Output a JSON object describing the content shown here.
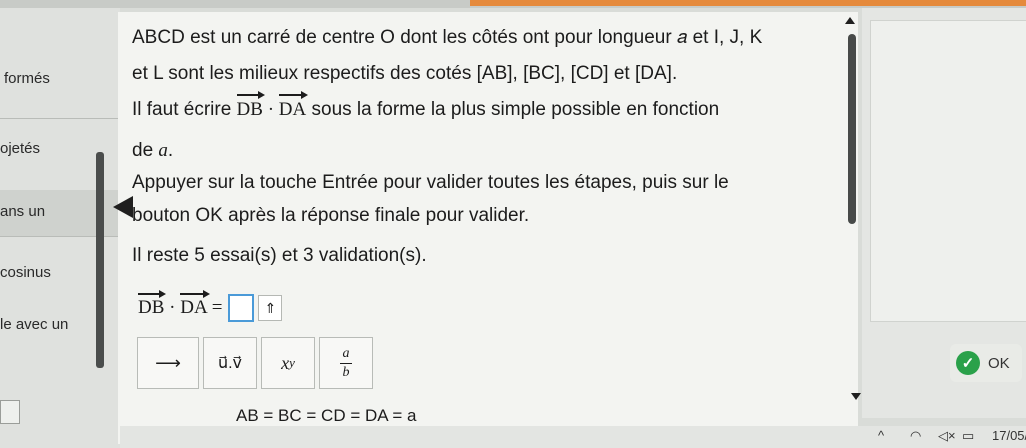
{
  "sidebar": {
    "items": [
      {
        "label": "formés"
      },
      {
        "label": "ojetés"
      },
      {
        "label": "ans un"
      },
      {
        "label": "cosinus"
      },
      {
        "label": "le avec un"
      }
    ]
  },
  "problem": {
    "line1": "ABCD est un carré de centre O dont les côtés ont pour longueur 𝑎 et I, J, K",
    "line2": "et L sont les milieux respectifs des cotés [AB], [BC], [CD] et [DA].",
    "line3_pre": "Il faut écrire ",
    "vec1": "DB",
    "dot": " · ",
    "vec2": "DA",
    "line3_post": " sous la forme la plus simple possible en fonction",
    "line4_pre": "de ",
    "line4_var": "a",
    "line4_post": ".",
    "line5": "Appuyer sur la touche Entrée pour valider toutes les étapes, puis sur le",
    "line6": "bouton OK après la réponse finale pour valider.",
    "line7": "Il reste 5 essai(s) et 3 validation(s)."
  },
  "answer": {
    "vec1": "DB",
    "dot": " · ",
    "vec2": "DA",
    "equals": "=",
    "toggle_symbol": "⇑"
  },
  "toolbar": {
    "vector_arrow": "⟶",
    "dot_product": "u⃗.v⃗",
    "power": "x",
    "power_exp": "y",
    "frac_num": "a",
    "frac_den": "b"
  },
  "footer": {
    "equation": "AB = BC = CD = DA = a"
  },
  "ok_button": {
    "label": "OK",
    "check": "✓"
  },
  "taskbar": {
    "date": "17/05/"
  },
  "colors": {
    "ok_green": "#2aa14a",
    "topbar_orange": "#e58a3c"
  }
}
